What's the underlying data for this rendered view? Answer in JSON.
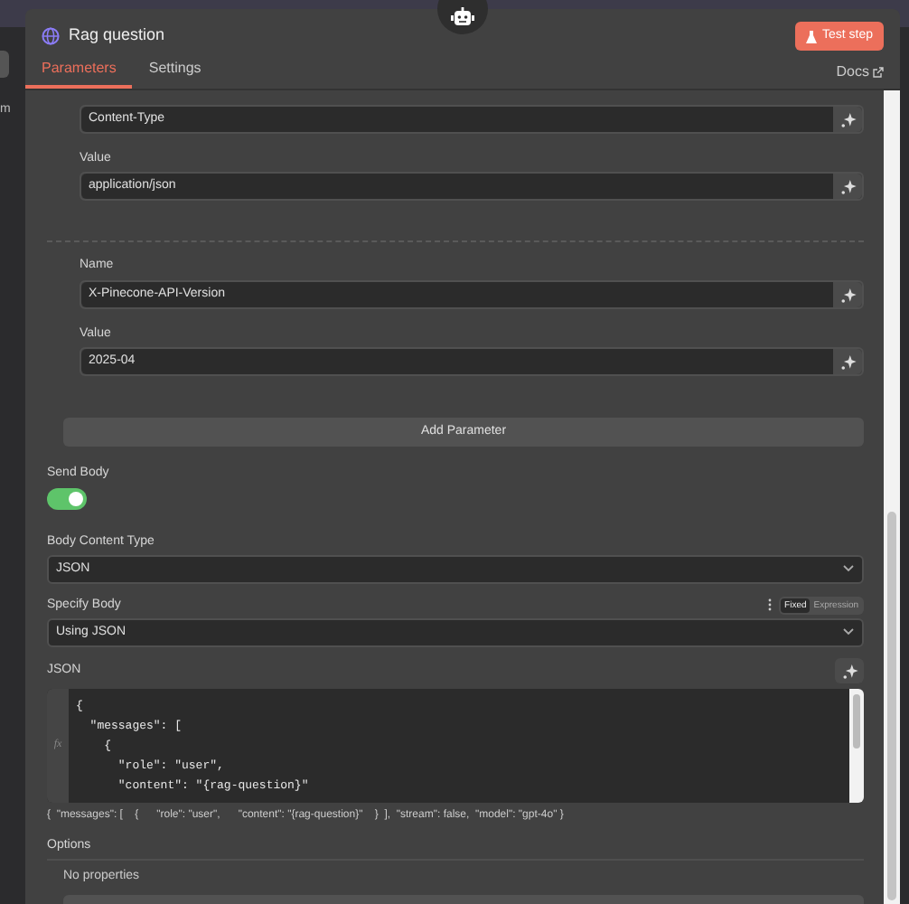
{
  "left_edge": {
    "text": "m"
  },
  "node": {
    "title": "Rag question",
    "test_button": "Test step"
  },
  "tabs": [
    {
      "label": "Parameters",
      "selected": true
    },
    {
      "label": "Settings",
      "selected": false
    }
  ],
  "docs_link": "Docs",
  "headers": [
    {
      "name": "Content-Type",
      "value_label": "Value",
      "value": "application/json"
    },
    {
      "name_label": "Name",
      "name": "X-Pinecone-API-Version",
      "value_label": "Value",
      "value": "2025-04"
    }
  ],
  "add_parameter": "Add Parameter",
  "send_body": {
    "label": "Send Body",
    "on": true
  },
  "body_content_type": {
    "label": "Body Content Type",
    "value": "JSON"
  },
  "specify_body": {
    "label": "Specify Body",
    "modes": [
      {
        "label": "Fixed",
        "selected": true
      },
      {
        "label": "Expression",
        "selected": false
      }
    ],
    "value": "Using JSON"
  },
  "json_field": {
    "label": "JSON",
    "gutter": "fx",
    "lines": [
      "{",
      "  \"messages\": [",
      "    {",
      "      \"role\": \"user\",",
      "      \"content\": \"{rag-question}\""
    ],
    "preview": "{  \"messages\": [    {      \"role\": \"user\",      \"content\": \"{rag-question}\"    }  ],  \"stream\": false,  \"model\": \"gpt-4o\" }"
  },
  "options": {
    "label": "Options",
    "empty_text": "No properties"
  }
}
